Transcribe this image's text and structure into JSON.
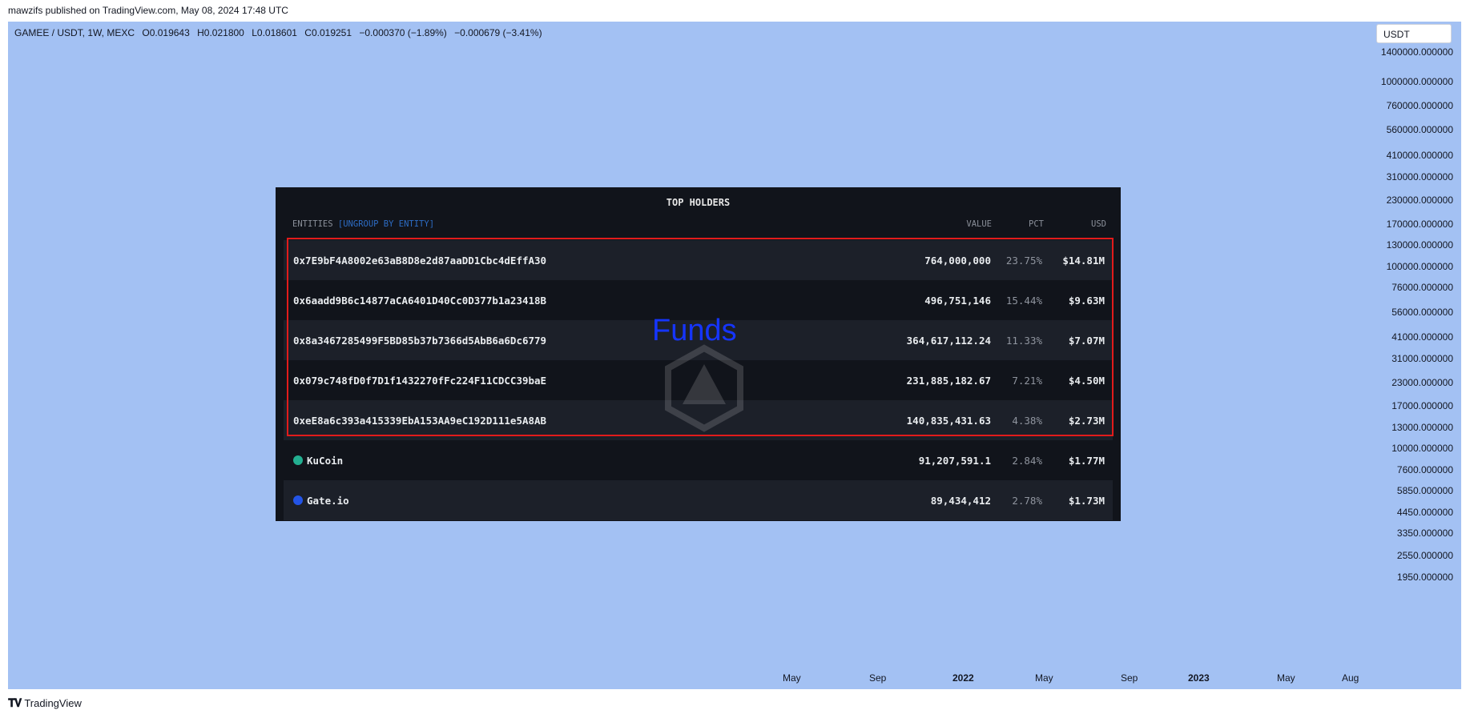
{
  "publisher": "mawzifs published on TradingView.com, May 08, 2024 17:48 UTC",
  "symbol": {
    "title": "GAMEE / USDT, 1W, MEXC",
    "open_label": "O",
    "open": "0.019643",
    "high_label": "H",
    "high": "0.021800",
    "low_label": "L",
    "low": "0.018601",
    "close_label": "C",
    "close": "0.019251",
    "change": "−0.000370 (−1.89%)",
    "change2": "−0.000679 (−3.41%)"
  },
  "currency_selector": "USDT",
  "y_axis_labels": [
    "1400000.000000",
    "1000000.000000",
    "760000.000000",
    "560000.000000",
    "410000.000000",
    "310000.000000",
    "230000.000000",
    "170000.000000",
    "130000.000000",
    "100000.000000",
    "76000.000000",
    "56000.000000",
    "41000.000000",
    "31000.000000",
    "23000.000000",
    "17000.000000",
    "13000.000000",
    "10000.000000",
    "7600.000000",
    "5850.000000",
    "4450.000000",
    "3350.000000",
    "2550.000000",
    "1950.000000"
  ],
  "x_axis_labels": [
    "May",
    "Sep",
    "2022",
    "May",
    "Sep",
    "2023",
    "May",
    "Aug"
  ],
  "footer_logo": "TradingView",
  "holders": {
    "title": "TOP HOLDERS",
    "entities_label": "ENTITIES",
    "ungroup_label": "[UNGROUP BY ENTITY]",
    "col_value": "VALUE",
    "col_pct": "PCT",
    "col_usd": "USD",
    "rows": [
      {
        "name": "0x7E9bF4A8002e63aB8D8e2d87aaDD1Cbc4dEffA30",
        "value": "764,000,000",
        "pct": "23.75%",
        "usd": "$14.81M"
      },
      {
        "name": "0x6aadd9B6c14877aCA6401D40Cc0D377b1a23418B",
        "value": "496,751,146",
        "pct": "15.44%",
        "usd": "$9.63M"
      },
      {
        "name": "0x8a3467285499F5BD85b37b7366d5AbB6a6Dc6779",
        "value": "364,617,112.24",
        "pct": "11.33%",
        "usd": "$7.07M"
      },
      {
        "name": "0x079c748fD0f7D1f1432270fFc224F11CDCC39baE",
        "value": "231,885,182.67",
        "pct": "7.21%",
        "usd": "$4.50M"
      },
      {
        "name": "0xeE8a6c393a415339EbA153AA9eC192D111e5A8AB",
        "value": "140,835,431.63",
        "pct": "4.38%",
        "usd": "$2.73M"
      },
      {
        "name": "KuCoin",
        "value": "91,207,591.1",
        "pct": "2.84%",
        "usd": "$1.77M",
        "icon_color": "#23af91"
      },
      {
        "name": "Gate.io",
        "value": "89,434,412",
        "pct": "2.78%",
        "usd": "$1.73M",
        "icon_color": "#2354e6"
      }
    ]
  },
  "annotation": "Funds",
  "colors": {
    "chart_bg": "#a3c1f3",
    "panel_bg": "#11141b",
    "highlight": "#e21b1b",
    "annotation": "#1535ff"
  }
}
